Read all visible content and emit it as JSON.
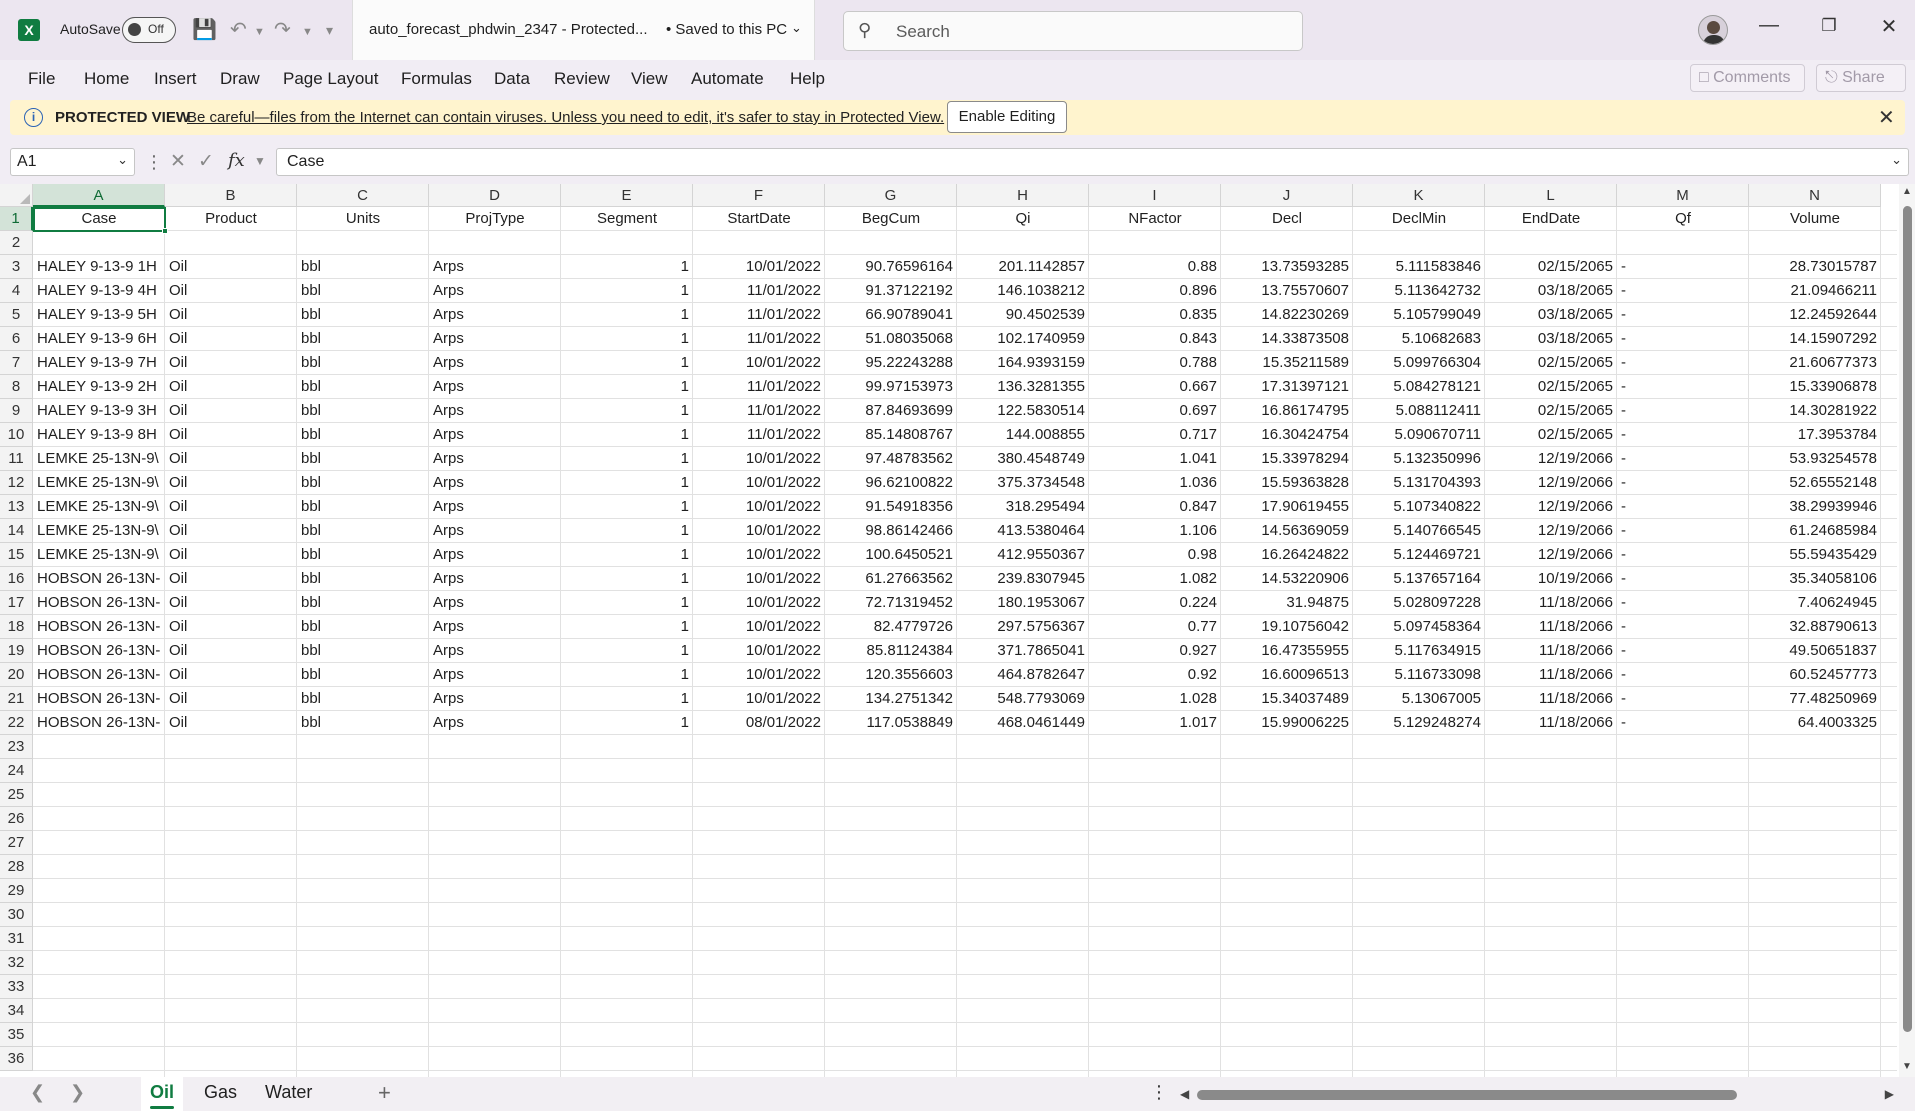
{
  "titlebar": {
    "autosave_label": "AutoSave",
    "autosave_state": "Off",
    "doc_title": "auto_forecast_phdwin_2347  -  Protected...",
    "saved_status": "• Saved to this PC",
    "search_placeholder": "Search"
  },
  "menu": [
    "File",
    "Home",
    "Insert",
    "Draw",
    "Page Layout",
    "Formulas",
    "Data",
    "Review",
    "View",
    "Automate",
    "Help"
  ],
  "menu_buttons": {
    "comments": "Comments",
    "share": "Share"
  },
  "protected_view": {
    "title": "PROTECTED VIEW",
    "message": "Be careful—files from the Internet can contain viruses. Unless you need to edit, it's safer to stay in Protected View.",
    "button": "Enable Editing"
  },
  "formula_bar": {
    "name_box": "A1",
    "fx": "fx",
    "content": "Case"
  },
  "columns": [
    "A",
    "B",
    "C",
    "D",
    "E",
    "F",
    "G",
    "H",
    "I",
    "J",
    "K",
    "L",
    "M",
    "N"
  ],
  "row_numbers": [
    "1",
    "2",
    "3",
    "4",
    "5",
    "6",
    "7",
    "8",
    "9",
    "10",
    "11",
    "12",
    "13",
    "14",
    "15",
    "16",
    "17",
    "18",
    "19",
    "20",
    "21",
    "22",
    "23",
    "24",
    "25",
    "26",
    "27",
    "28",
    "29",
    "30",
    "31",
    "32",
    "33",
    "34",
    "35",
    "36"
  ],
  "header_row": [
    "Case",
    "Product",
    "Units",
    "ProjType",
    "Segment",
    "StartDate",
    "BegCum",
    "Qi",
    "NFactor",
    "Decl",
    "DeclMin",
    "EndDate",
    "Qf",
    "Volume"
  ],
  "data_rows": [
    [
      "HALEY 9-13-9 1H",
      "Oil",
      "bbl",
      "Arps",
      "1",
      "10/01/2022",
      "90.76596164",
      "201.1142857",
      "0.88",
      "13.73593285",
      "5.111583846",
      "02/15/2065",
      "-",
      "28.73015787"
    ],
    [
      "HALEY 9-13-9 4H",
      "Oil",
      "bbl",
      "Arps",
      "1",
      "11/01/2022",
      "91.37122192",
      "146.1038212",
      "0.896",
      "13.75570607",
      "5.113642732",
      "03/18/2065",
      "-",
      "21.09466211"
    ],
    [
      "HALEY 9-13-9 5H",
      "Oil",
      "bbl",
      "Arps",
      "1",
      "11/01/2022",
      "66.90789041",
      "90.4502539",
      "0.835",
      "14.82230269",
      "5.105799049",
      "03/18/2065",
      "-",
      "12.24592644"
    ],
    [
      "HALEY 9-13-9 6H",
      "Oil",
      "bbl",
      "Arps",
      "1",
      "11/01/2022",
      "51.08035068",
      "102.1740959",
      "0.843",
      "14.33873508",
      "5.10682683",
      "03/18/2065",
      "-",
      "14.15907292"
    ],
    [
      "HALEY 9-13-9 7H",
      "Oil",
      "bbl",
      "Arps",
      "1",
      "10/01/2022",
      "95.22243288",
      "164.9393159",
      "0.788",
      "15.35211589",
      "5.099766304",
      "02/15/2065",
      "-",
      "21.60677373"
    ],
    [
      "HALEY 9-13-9 2H",
      "Oil",
      "bbl",
      "Arps",
      "1",
      "11/01/2022",
      "99.97153973",
      "136.3281355",
      "0.667",
      "17.31397121",
      "5.084278121",
      "02/15/2065",
      "-",
      "15.33906878"
    ],
    [
      "HALEY 9-13-9 3H",
      "Oil",
      "bbl",
      "Arps",
      "1",
      "11/01/2022",
      "87.84693699",
      "122.5830514",
      "0.697",
      "16.86174795",
      "5.088112411",
      "02/15/2065",
      "-",
      "14.30281922"
    ],
    [
      "HALEY 9-13-9 8H",
      "Oil",
      "bbl",
      "Arps",
      "1",
      "11/01/2022",
      "85.14808767",
      "144.008855",
      "0.717",
      "16.30424754",
      "5.090670711",
      "02/15/2065",
      "-",
      "17.3953784"
    ],
    [
      "LEMKE 25-13N-9\\",
      "Oil",
      "bbl",
      "Arps",
      "1",
      "10/01/2022",
      "97.48783562",
      "380.4548749",
      "1.041",
      "15.33978294",
      "5.132350996",
      "12/19/2066",
      "-",
      "53.93254578"
    ],
    [
      "LEMKE 25-13N-9\\",
      "Oil",
      "bbl",
      "Arps",
      "1",
      "10/01/2022",
      "96.62100822",
      "375.3734548",
      "1.036",
      "15.59363828",
      "5.131704393",
      "12/19/2066",
      "-",
      "52.65552148"
    ],
    [
      "LEMKE 25-13N-9\\",
      "Oil",
      "bbl",
      "Arps",
      "1",
      "10/01/2022",
      "91.54918356",
      "318.295494",
      "0.847",
      "17.90619455",
      "5.107340822",
      "12/19/2066",
      "-",
      "38.29939946"
    ],
    [
      "LEMKE 25-13N-9\\",
      "Oil",
      "bbl",
      "Arps",
      "1",
      "10/01/2022",
      "98.86142466",
      "413.5380464",
      "1.106",
      "14.56369059",
      "5.140766545",
      "12/19/2066",
      "-",
      "61.24685984"
    ],
    [
      "LEMKE 25-13N-9\\",
      "Oil",
      "bbl",
      "Arps",
      "1",
      "10/01/2022",
      "100.6450521",
      "412.9550367",
      "0.98",
      "16.26424822",
      "5.124469721",
      "12/19/2066",
      "-",
      "55.59435429"
    ],
    [
      "HOBSON 26-13N-",
      "Oil",
      "bbl",
      "Arps",
      "1",
      "10/01/2022",
      "61.27663562",
      "239.8307945",
      "1.082",
      "14.53220906",
      "5.137657164",
      "10/19/2066",
      "-",
      "35.34058106"
    ],
    [
      "HOBSON 26-13N-",
      "Oil",
      "bbl",
      "Arps",
      "1",
      "10/01/2022",
      "72.71319452",
      "180.1953067",
      "0.224",
      "31.94875",
      "5.028097228",
      "11/18/2066",
      "-",
      "7.40624945"
    ],
    [
      "HOBSON 26-13N-",
      "Oil",
      "bbl",
      "Arps",
      "1",
      "10/01/2022",
      "82.4779726",
      "297.5756367",
      "0.77",
      "19.10756042",
      "5.097458364",
      "11/18/2066",
      "-",
      "32.88790613"
    ],
    [
      "HOBSON 26-13N-",
      "Oil",
      "bbl",
      "Arps",
      "1",
      "10/01/2022",
      "85.81124384",
      "371.7865041",
      "0.927",
      "16.47355955",
      "5.117634915",
      "11/18/2066",
      "-",
      "49.50651837"
    ],
    [
      "HOBSON 26-13N-",
      "Oil",
      "bbl",
      "Arps",
      "1",
      "10/01/2022",
      "120.3556603",
      "464.8782647",
      "0.92",
      "16.60096513",
      "5.116733098",
      "11/18/2066",
      "-",
      "60.52457773"
    ],
    [
      "HOBSON 26-13N-",
      "Oil",
      "bbl",
      "Arps",
      "1",
      "10/01/2022",
      "134.2751342",
      "548.7793069",
      "1.028",
      "15.34037489",
      "5.13067005",
      "11/18/2066",
      "-",
      "77.48250969"
    ],
    [
      "HOBSON 26-13N-",
      "Oil",
      "bbl",
      "Arps",
      "1",
      "08/01/2022",
      "117.0538849",
      "468.0461449",
      "1.017",
      "15.99006225",
      "5.129248274",
      "11/18/2066",
      "-",
      "64.4003325"
    ]
  ],
  "sheets": [
    "Oil",
    "Gas",
    "Water"
  ],
  "active_sheet": "Oil",
  "colors": {
    "accent": "#107c41",
    "protected_bar": "#fff4ce",
    "brand_purple": "#7a5ea8"
  }
}
